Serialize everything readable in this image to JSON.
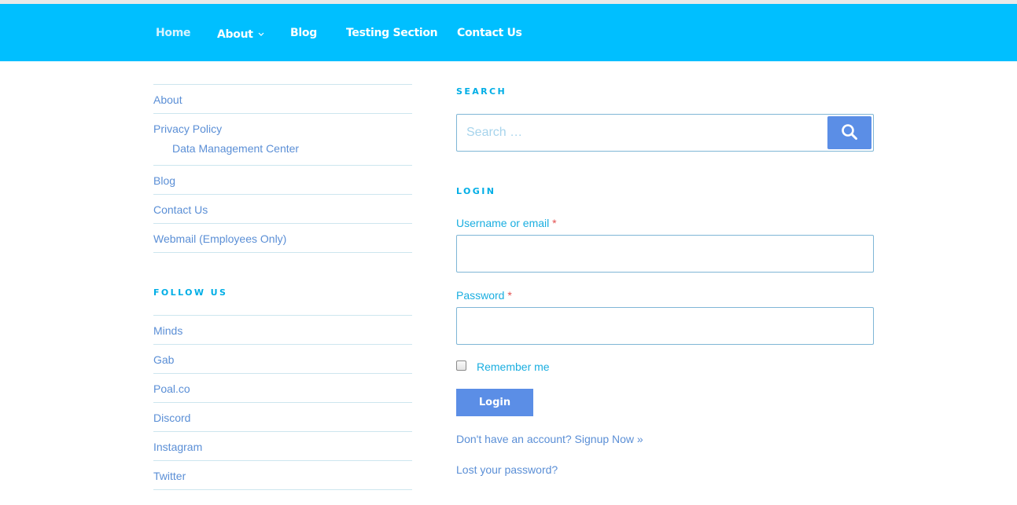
{
  "nav": {
    "items": [
      {
        "label": "Home"
      },
      {
        "label": "About"
      },
      {
        "label": "Blog"
      },
      {
        "label": "Testing Section"
      },
      {
        "label": "Contact Us"
      }
    ]
  },
  "pages_menu": {
    "items": [
      {
        "label": "About"
      },
      {
        "label": "Privacy Policy",
        "sub": "Data Management Center"
      },
      {
        "label": "Blog"
      },
      {
        "label": "Contact Us"
      },
      {
        "label": "Webmail (Employees Only)"
      }
    ]
  },
  "follow": {
    "title": "FOLLOW US",
    "items": [
      {
        "label": "Minds"
      },
      {
        "label": "Gab"
      },
      {
        "label": "Poal.co"
      },
      {
        "label": "Discord"
      },
      {
        "label": "Instagram"
      },
      {
        "label": "Twitter"
      }
    ]
  },
  "search": {
    "title": "SEARCH",
    "placeholder": "Search …",
    "icon": "search-icon"
  },
  "login": {
    "title": "LOGIN",
    "username_label": "Username or email",
    "password_label": "Password",
    "required_mark": "*",
    "remember_label": "Remember me",
    "button_label": "Login",
    "signup_link": "Don't have an account? Signup Now »",
    "lost_password_link": "Lost your password?"
  },
  "colors": {
    "nav_bg": "#00bfff",
    "accent": "#5b8ee6",
    "link": "#5b8fd6",
    "heading": "#00aee6"
  }
}
